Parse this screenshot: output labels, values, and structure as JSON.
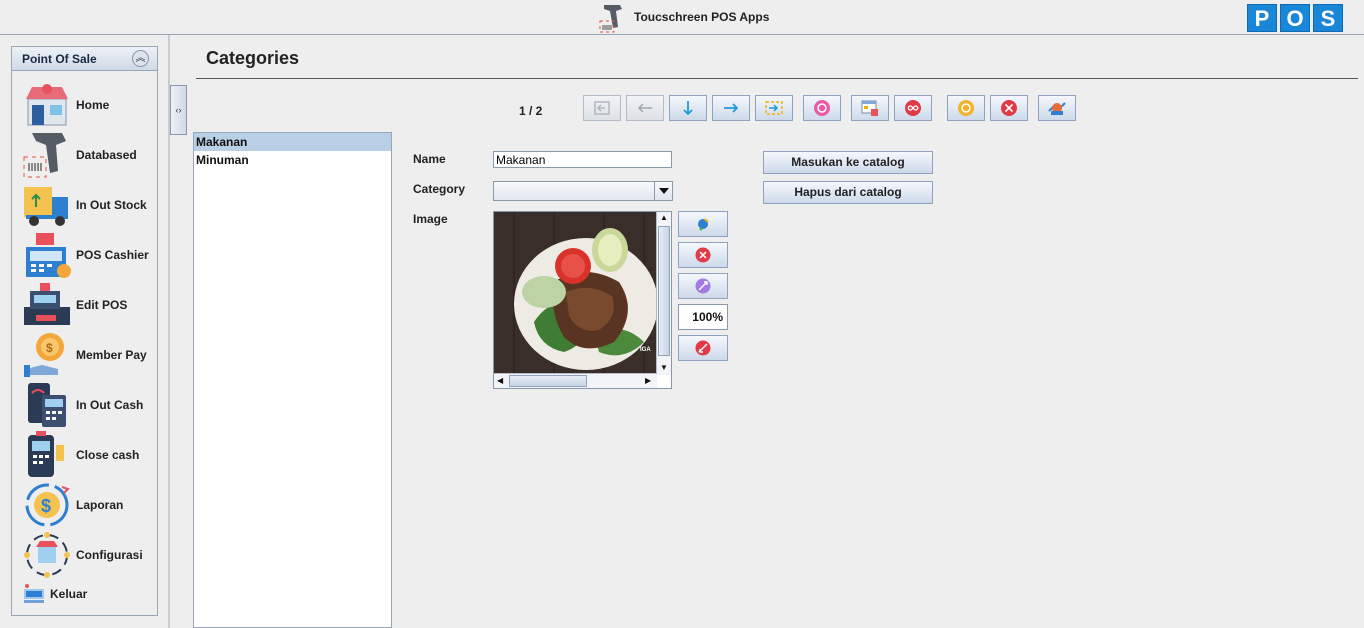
{
  "window": {
    "title": "Toucschreen POS Apps",
    "logo_letters": [
      "P",
      "O",
      "S"
    ],
    "brand_color": "#1a86d8"
  },
  "sidebar": {
    "title": "Point Of Sale",
    "collapse_icon": "double-chevron-up-icon",
    "items": [
      {
        "label": "Home",
        "icon": "store-icon"
      },
      {
        "label": "Databased",
        "icon": "barcode-scanner-icon"
      },
      {
        "label": "In Out Stock",
        "icon": "delivery-truck-icon"
      },
      {
        "label": "POS Cashier",
        "icon": "cash-register-icon"
      },
      {
        "label": "Edit POS",
        "icon": "pos-terminal-icon"
      },
      {
        "label": "Member Pay",
        "icon": "coin-hand-icon"
      },
      {
        "label": "In Out Cash",
        "icon": "card-reader-icon"
      },
      {
        "label": "Close cash",
        "icon": "payment-terminal-icon"
      },
      {
        "label": "Laporan",
        "icon": "dollar-cycle-icon"
      },
      {
        "label": "Configurasi",
        "icon": "shop-network-icon"
      },
      {
        "label": "Keluar",
        "icon": "exit-sign-icon"
      }
    ]
  },
  "main": {
    "title": "Categories",
    "pager": "1 / 2",
    "toolbar": [
      {
        "name": "first-record",
        "icon": "first-icon",
        "enabled": false
      },
      {
        "name": "previous-record",
        "icon": "arrow-left-icon",
        "enabled": false
      },
      {
        "name": "down-record",
        "icon": "arrow-down-icon",
        "enabled": true
      },
      {
        "name": "next-record",
        "icon": "arrow-right-icon",
        "enabled": true
      },
      {
        "name": "last-record",
        "icon": "last-icon",
        "enabled": true
      },
      {
        "name": "reload",
        "icon": "reload-icon",
        "enabled": true
      },
      {
        "name": "find",
        "icon": "find-icon",
        "enabled": true
      },
      {
        "name": "sort",
        "icon": "sort-icon",
        "enabled": true
      },
      {
        "name": "new",
        "icon": "new-icon",
        "enabled": true
      },
      {
        "name": "delete",
        "icon": "delete-icon",
        "enabled": true
      },
      {
        "name": "save",
        "icon": "save-icon",
        "enabled": true
      }
    ],
    "list": [
      {
        "label": "Makanan",
        "selected": true
      },
      {
        "label": "Minuman",
        "selected": false
      }
    ],
    "form": {
      "name_label": "Name",
      "name_value": "Makanan",
      "category_label": "Category",
      "category_value": "",
      "image_label": "Image",
      "image_watermark": "IGA",
      "zoom": "100%"
    },
    "actions": {
      "add_catalog": "Masukan ke catalog",
      "remove_catalog": "Hapus dari catalog"
    }
  }
}
